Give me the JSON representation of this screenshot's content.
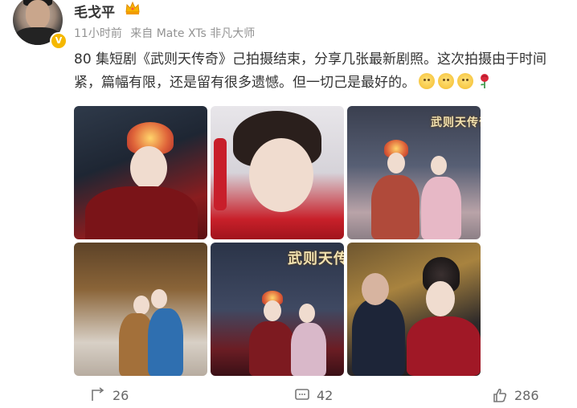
{
  "user": {
    "name": "毛戈平",
    "verified_badge": "V",
    "time": "11小时前",
    "source": "来自 Mate XTs 非凡大师",
    "icons": [
      "crown-icon",
      "verified-badge-icon"
    ]
  },
  "post": {
    "line1": "80 集短剧《武则天传奇》己拍摄结束，分享几张最新剧照。这次拍摄由于时间",
    "line2": "紧，篇幅有限，还是留有很多遗憾。但一切己是最好的。",
    "emojis": [
      "smile-emoji",
      "smile-emoji",
      "smile-emoji",
      "rose-emoji"
    ]
  },
  "photos": {
    "title_overlay": "武则天传奇",
    "count": 6
  },
  "actions": {
    "repost_count": "26",
    "comment_count": "42",
    "like_count": "286"
  },
  "colors": {
    "accent_gold": "#f5b800",
    "text_primary": "#333333",
    "text_meta": "#939393"
  }
}
